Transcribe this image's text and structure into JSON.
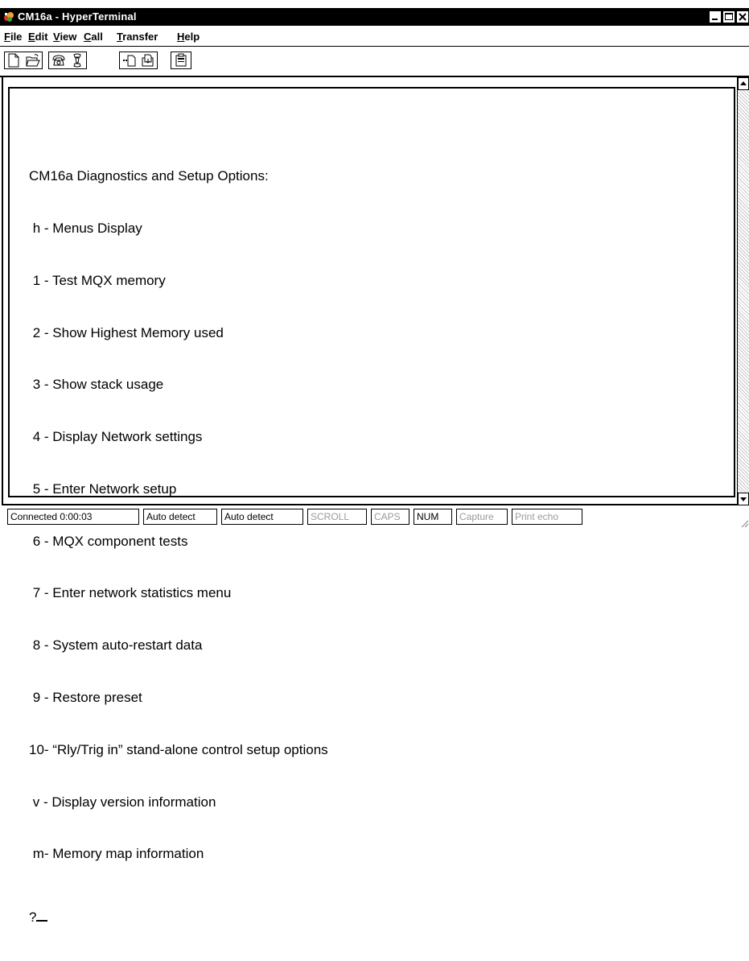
{
  "window": {
    "title": "CM16a - HyperTerminal",
    "controls": [
      "minimize-icon",
      "maximize-icon",
      "close-icon"
    ]
  },
  "menubar": {
    "items": [
      {
        "key": "F",
        "rest": "ile"
      },
      {
        "key": "E",
        "rest": "dit"
      },
      {
        "key": "V",
        "rest": "iew"
      },
      {
        "key": "C",
        "rest": "all"
      },
      {
        "key": "T",
        "rest": "ransfer"
      },
      {
        "key": "H",
        "rest": "elp"
      }
    ]
  },
  "toolbar": {
    "buttons": [
      "new-icon",
      "open-icon",
      "connect-icon",
      "disconnect-icon",
      "send-icon",
      "receive-icon",
      "properties-icon"
    ]
  },
  "terminal": {
    "lines": [
      "CM16a Diagnostics and Setup Options:",
      " h - Menus Display",
      " 1 - Test MQX memory",
      " 2 - Show Highest Memory used",
      " 3 - Show stack usage",
      " 4 - Display Network settings",
      " 5 - Enter Network setup",
      " 6 - MQX component tests",
      " 7 - Enter network statistics menu",
      " 8 - System auto-restart data",
      " 9 - Restore preset",
      "10- “Rly/Trig in” stand-alone control setup options",
      " v - Display version information",
      " m- Memory map information"
    ],
    "prompt": "?"
  },
  "statusbar": {
    "connected": "Connected 0:00:03",
    "detect1": "Auto detect",
    "detect2": "Auto detect",
    "scroll": "SCROLL",
    "caps": "CAPS",
    "num": "NUM",
    "capture": "Capture",
    "print_echo": "Print echo"
  }
}
